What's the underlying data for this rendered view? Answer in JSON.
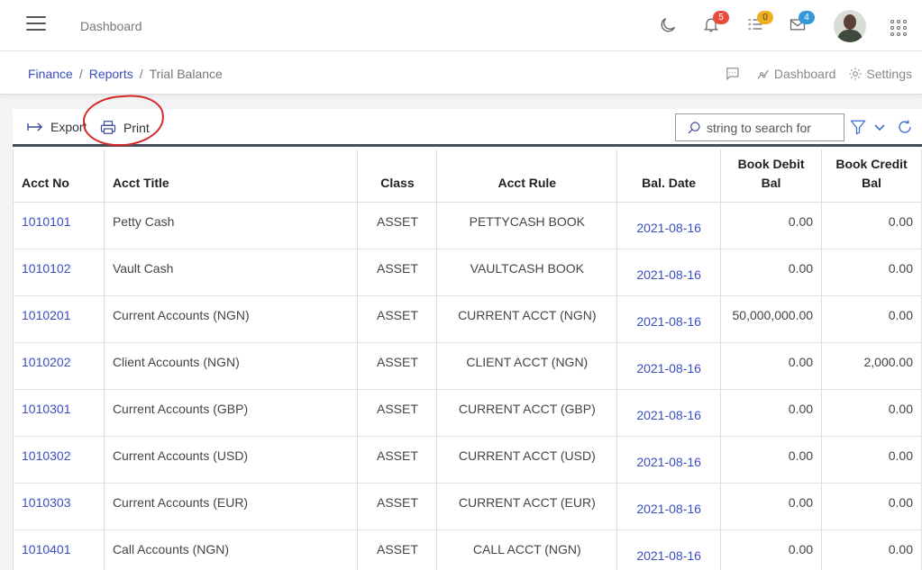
{
  "header": {
    "title": "Dashboard",
    "badges": {
      "notifications": "5",
      "tasks": "0",
      "messages": "4"
    }
  },
  "breadcrumb": {
    "items": [
      "Finance",
      "Reports"
    ],
    "separator": "/",
    "current": "Trial Balance",
    "actions": {
      "dashboard": "Dashboard",
      "settings": "Settings"
    }
  },
  "toolbar": {
    "export_label": "Export",
    "print_label": "Print",
    "search_placeholder": "string to search for"
  },
  "table": {
    "columns": [
      "Acct No",
      "Acct Title",
      "Class",
      "Acct Rule",
      "Bal. Date",
      "Book Debit Bal",
      "Book Credit Bal"
    ],
    "rows": [
      {
        "acct_no": "1010101",
        "title": "Petty Cash",
        "class": "ASSET",
        "rule": "PETTYCASH BOOK",
        "date": "2021-08-16",
        "debit": "0.00",
        "credit": "0.00"
      },
      {
        "acct_no": "1010102",
        "title": "Vault Cash",
        "class": "ASSET",
        "rule": "VAULTCASH BOOK",
        "date": "2021-08-16",
        "debit": "0.00",
        "credit": "0.00"
      },
      {
        "acct_no": "1010201",
        "title": "Current Accounts (NGN)",
        "class": "ASSET",
        "rule": "CURRENT ACCT (NGN)",
        "date": "2021-08-16",
        "debit": "50,000,000.00",
        "credit": "0.00"
      },
      {
        "acct_no": "1010202",
        "title": "Client Accounts (NGN)",
        "class": "ASSET",
        "rule": "CLIENT ACCT (NGN)",
        "date": "2021-08-16",
        "debit": "0.00",
        "credit": "2,000.00"
      },
      {
        "acct_no": "1010301",
        "title": "Current Accounts (GBP)",
        "class": "ASSET",
        "rule": "CURRENT ACCT (GBP)",
        "date": "2021-08-16",
        "debit": "0.00",
        "credit": "0.00"
      },
      {
        "acct_no": "1010302",
        "title": "Current Accounts (USD)",
        "class": "ASSET",
        "rule": "CURRENT ACCT (USD)",
        "date": "2021-08-16",
        "debit": "0.00",
        "credit": "0.00"
      },
      {
        "acct_no": "1010303",
        "title": "Current Accounts (EUR)",
        "class": "ASSET",
        "rule": "CURRENT ACCT (EUR)",
        "date": "2021-08-16",
        "debit": "0.00",
        "credit": "0.00"
      },
      {
        "acct_no": "1010401",
        "title": "Call Accounts (NGN)",
        "class": "ASSET",
        "rule": "CALL ACCT (NGN)",
        "date": "2021-08-16",
        "debit": "0.00",
        "credit": "0.00"
      }
    ]
  },
  "icons": [
    "menu-icon",
    "moon-icon",
    "bell-icon",
    "task-list-icon",
    "envelope-icon",
    "apps-grid-icon",
    "chat-icon",
    "chart-line-icon",
    "gear-icon",
    "export-arrow-icon",
    "printer-icon",
    "search-icon",
    "filter-icon",
    "chevron-down-icon",
    "refresh-icon"
  ],
  "colors": {
    "link": "#3a4dbf",
    "annotation": "#d62828",
    "header_rule": "#444c57"
  }
}
